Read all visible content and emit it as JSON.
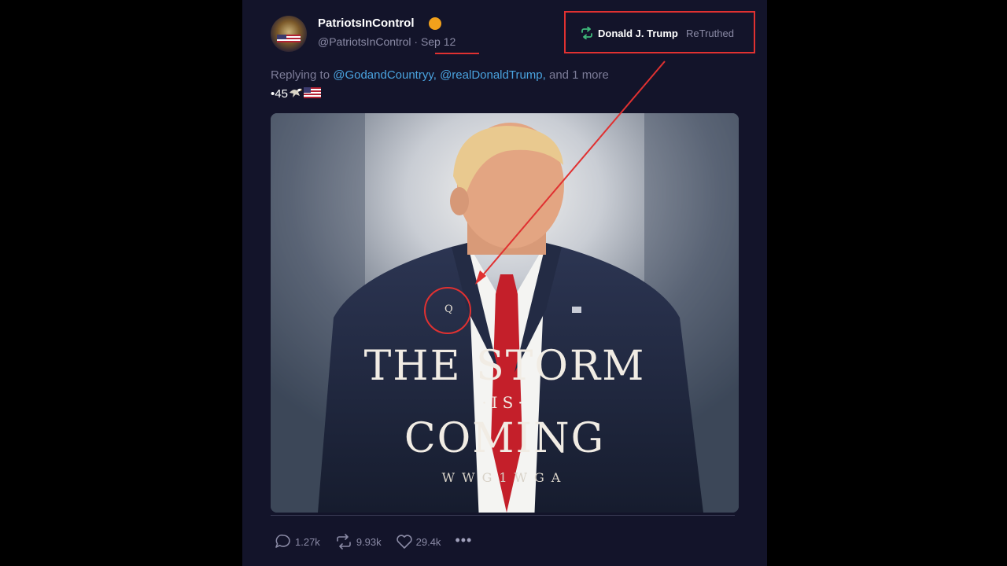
{
  "post": {
    "display_name": "PatriotsInControl",
    "handle": "@PatriotsInControl",
    "separator": "·",
    "date": "Sep 12",
    "retruth": {
      "name": "Donald J. Trump",
      "verb": "ReTruthed"
    },
    "reply": {
      "prefix": "Replying to",
      "mention_1": "@GodandCountryy,",
      "mention_2": "@realDonaldTrump,",
      "suffix": "and 1 more"
    },
    "text": "•45"
  },
  "media": {
    "line_1": "THE STORM",
    "line_2": "·IS·",
    "line_3": "COMING",
    "line_4": "WWG1WGA",
    "pin_letter": "Q"
  },
  "actions": {
    "replies": "1.27k",
    "retruths": "9.93k",
    "likes": "29.4k",
    "more": "•••"
  },
  "colors": {
    "background": "#13142a",
    "annotation_red": "#e03131",
    "mention_blue": "#4aa3df",
    "verified_orange": "#f2a11b"
  },
  "icons": [
    "verified-badge-icon",
    "retruth-icon",
    "eagle-icon",
    "us-flag-icon",
    "reply-icon",
    "like-icon",
    "more-icon"
  ]
}
